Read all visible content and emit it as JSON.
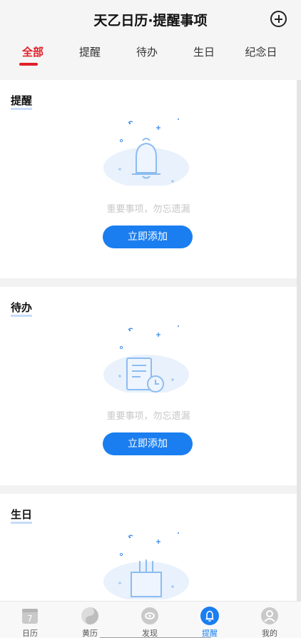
{
  "header": {
    "title": "天乙日历·提醒事项",
    "add_icon": "plus-circle-icon"
  },
  "tabs": [
    "全部",
    "提醒",
    "待办",
    "生日",
    "纪念日"
  ],
  "active_tab": 0,
  "sections": [
    {
      "title": "提醒",
      "empty_text": "重要事项，勿忘遗漏",
      "button": "立即添加",
      "icon": "bell-icon"
    },
    {
      "title": "待办",
      "empty_text": "重要事项，勿忘遗漏",
      "button": "立即添加",
      "icon": "document-clock-icon"
    },
    {
      "title": "生日",
      "icon": "birthday-cake-icon"
    }
  ],
  "bottom_nav": [
    {
      "label": "日历",
      "icon": "calendar-icon",
      "day": "7"
    },
    {
      "label": "黄历",
      "icon": "yin-yang-icon"
    },
    {
      "label": "发现",
      "icon": "discover-icon"
    },
    {
      "label": "提醒",
      "icon": "bell-icon",
      "active": true
    },
    {
      "label": "我的",
      "icon": "user-icon"
    }
  ],
  "colors": {
    "accent_red": "#e0202a",
    "primary_blue": "#1a7ef0",
    "illustration_bg": "#e8f1fc"
  }
}
